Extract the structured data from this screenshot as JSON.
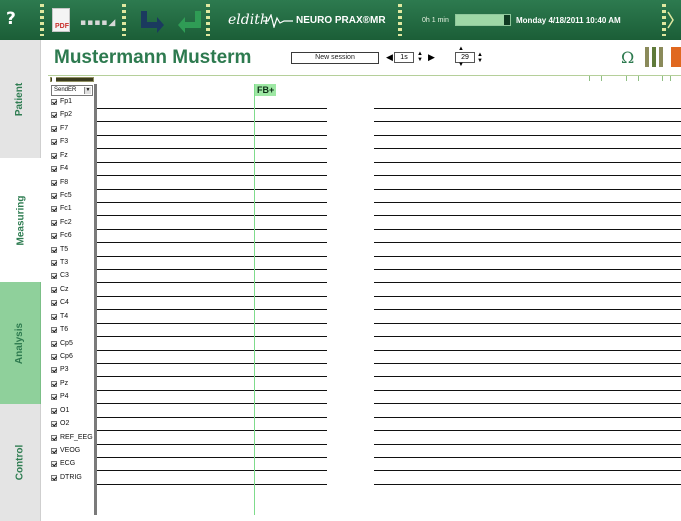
{
  "toolbar": {
    "help": "?",
    "pdf_label": "PDF",
    "brand": "eldith",
    "product": "NEURO PRAX®MR",
    "elapsed": "0h 1 min",
    "progress": 0.88,
    "datetime": "Monday  4/18/2011  10:40 AM"
  },
  "tabs": [
    "Patient",
    "Measuring",
    "Analysis",
    "Control"
  ],
  "header": {
    "patient_name": "Mustermann  Musterm",
    "session_button": "New session",
    "time_scale": "1s",
    "scale_value": "29",
    "omega": "Ω"
  },
  "eeg": {
    "montage_select": "SendER",
    "fb_marker": "FB+",
    "channels": [
      "Fp1",
      "Fp2",
      "F7",
      "F3",
      "Fz",
      "F4",
      "F8",
      "Fc5",
      "Fc1",
      "Fc2",
      "Fc6",
      "T5",
      "T3",
      "C3",
      "Cz",
      "C4",
      "T4",
      "T6",
      "Cp5",
      "Cp6",
      "P3",
      "Pz",
      "P4",
      "O1",
      "O2",
      "REF_EEG",
      "VEOG",
      "ECG",
      "DTRIG"
    ]
  },
  "colors": {
    "toolbar": "#1b5e37",
    "accent_green": "#2d7a4f",
    "analysis_tab": "#8fd09b",
    "marker_green": "#7fdc8c"
  }
}
